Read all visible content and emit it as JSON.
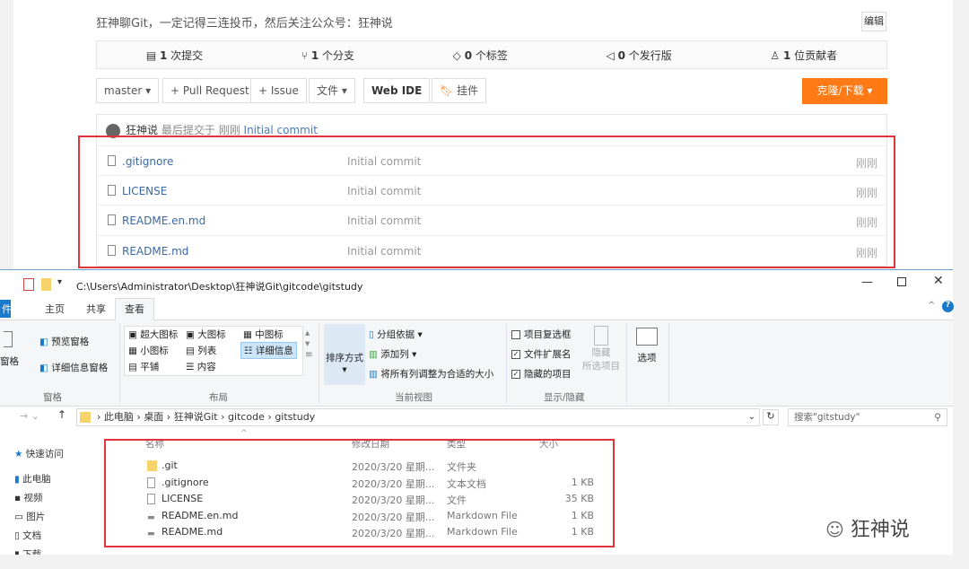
{
  "repo": {
    "description": "狂神聊Git，一定记得三连投币，然后关注公众号：狂神说",
    "edit_label": "编辑",
    "stats": [
      {
        "icon": "commit-icon",
        "value": "1",
        "label": "次提交"
      },
      {
        "icon": "branch-icon",
        "value": "1",
        "label": "个分支"
      },
      {
        "icon": "tag-icon",
        "value": "0",
        "label": "个标签"
      },
      {
        "icon": "release-icon",
        "value": "0",
        "label": "个发行版"
      },
      {
        "icon": "contributor-icon",
        "value": "1",
        "label": "位贡献者"
      }
    ],
    "toolbar": {
      "branch": "master ▾",
      "pull_request": "+ Pull Request",
      "issue": "+ Issue",
      "file": "文件 ▾",
      "web_ide": "Web IDE",
      "plugin": "挂件",
      "clone": "克隆/下载 ▾"
    },
    "last_commit": {
      "user": "狂神说",
      "text": "最后提交于",
      "time": "刚刚",
      "message": "Initial commit"
    },
    "files": [
      {
        "name": ".gitignore",
        "commit": "Initial commit",
        "time": "刚刚"
      },
      {
        "name": "LICENSE",
        "commit": "Initial commit",
        "time": "刚刚"
      },
      {
        "name": "README.en.md",
        "commit": "Initial commit",
        "time": "刚刚"
      },
      {
        "name": "README.md",
        "commit": "Initial commit",
        "time": "刚刚"
      }
    ]
  },
  "explorer": {
    "path": "C:\\Users\\Administrator\\Desktop\\狂神说Git\\gitcode\\gitstudy",
    "tabs": [
      "件",
      "主页",
      "共享",
      "查看"
    ],
    "ribbon": {
      "panes": {
        "preview": "预览窗格",
        "details": "详细信息窗格",
        "nav": "窗格",
        "group": "窗格"
      },
      "layout": {
        "items": [
          "超大图标",
          "大图标",
          "中图标",
          "小图标",
          "列表",
          "详细信息",
          "平铺",
          "内容"
        ],
        "group": "布局"
      },
      "view": {
        "sort": "排序方式",
        "group_by": "分组依据 ▾",
        "add_col": "添加列 ▾",
        "fit": "将所有列调整为合适的大小",
        "group": "当前视图"
      },
      "show": {
        "checkbox": "项目复选框",
        "ext": "文件扩展名",
        "hidden": "隐藏的项目",
        "hide1": "隐藏",
        "hide2": "所选项目",
        "group": "显示/隐藏"
      },
      "options": "选项"
    },
    "breadcrumb": [
      "此电脑",
      "桌面",
      "狂神说Git",
      "gitcode",
      "gitstudy"
    ],
    "search_placeholder": "搜索\"gitstudy\"",
    "nav": [
      "快速访问",
      "此电脑",
      "视频",
      "图片",
      "文档",
      "下载"
    ],
    "columns": [
      "名称",
      "修改日期",
      "类型",
      "大小"
    ],
    "files": [
      {
        "name": ".git",
        "date": "2020/3/20 星期...",
        "type": "文件夹",
        "size": ""
      },
      {
        "name": ".gitignore",
        "date": "2020/3/20 星期...",
        "type": "文本文档",
        "size": "1 KB"
      },
      {
        "name": "LICENSE",
        "date": "2020/3/20 星期...",
        "type": "文件",
        "size": "35 KB"
      },
      {
        "name": "README.en.md",
        "date": "2020/3/20 星期...",
        "type": "Markdown File",
        "size": "1 KB"
      },
      {
        "name": "README.md",
        "date": "2020/3/20 星期...",
        "type": "Markdown File",
        "size": "1 KB"
      }
    ]
  },
  "watermark": "狂神说"
}
